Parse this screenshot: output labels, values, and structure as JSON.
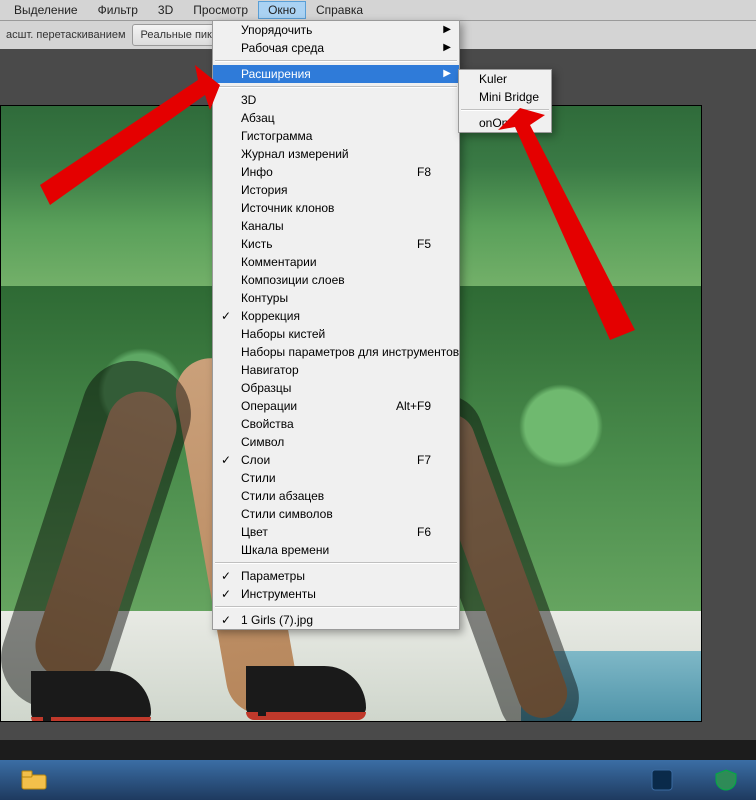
{
  "menubar": {
    "items": [
      {
        "label": "Выделение"
      },
      {
        "label": "Фильтр"
      },
      {
        "label": "3D"
      },
      {
        "label": "Просмотр"
      },
      {
        "label": "Окно",
        "selected": true
      },
      {
        "label": "Справка"
      }
    ]
  },
  "optionsBar": {
    "dragText": "асшт. перетаскиванием",
    "btn1": "Реальные пикселы"
  },
  "windowMenu": {
    "groups": [
      [
        {
          "label": "Упорядочить",
          "submenu": true
        },
        {
          "label": "Рабочая среда",
          "submenu": true
        }
      ],
      [
        {
          "label": "Расширения",
          "submenu": true,
          "highlighted": true
        }
      ],
      [
        {
          "label": "3D"
        },
        {
          "label": "Абзац"
        },
        {
          "label": "Гистограмма"
        },
        {
          "label": "Журнал измерений"
        },
        {
          "label": "Инфо",
          "shortcut": "F8"
        },
        {
          "label": "История"
        },
        {
          "label": "Источник клонов"
        },
        {
          "label": "Каналы"
        },
        {
          "label": "Кисть",
          "shortcut": "F5"
        },
        {
          "label": "Комментарии"
        },
        {
          "label": "Композиции слоев"
        },
        {
          "label": "Контуры"
        },
        {
          "label": "Коррекция",
          "checked": true
        },
        {
          "label": "Наборы кистей"
        },
        {
          "label": "Наборы параметров для инструментов"
        },
        {
          "label": "Навигатор"
        },
        {
          "label": "Образцы"
        },
        {
          "label": "Операции",
          "shortcut": "Alt+F9"
        },
        {
          "label": "Свойства"
        },
        {
          "label": "Символ"
        },
        {
          "label": "Слои",
          "checked": true,
          "shortcut": "F7"
        },
        {
          "label": "Стили"
        },
        {
          "label": "Стили абзацев"
        },
        {
          "label": "Стили символов"
        },
        {
          "label": "Цвет",
          "shortcut": "F6"
        },
        {
          "label": "Шкала времени"
        }
      ],
      [
        {
          "label": "Параметры",
          "checked": true
        },
        {
          "label": "Инструменты",
          "checked": true
        }
      ],
      [
        {
          "label": "1 Girls (7).jpg",
          "checked": true
        }
      ]
    ]
  },
  "extensionsSubmenu": {
    "groups": [
      [
        {
          "label": "Kuler"
        },
        {
          "label": "Mini Bridge"
        }
      ],
      [
        {
          "label": "onOne"
        }
      ]
    ]
  }
}
